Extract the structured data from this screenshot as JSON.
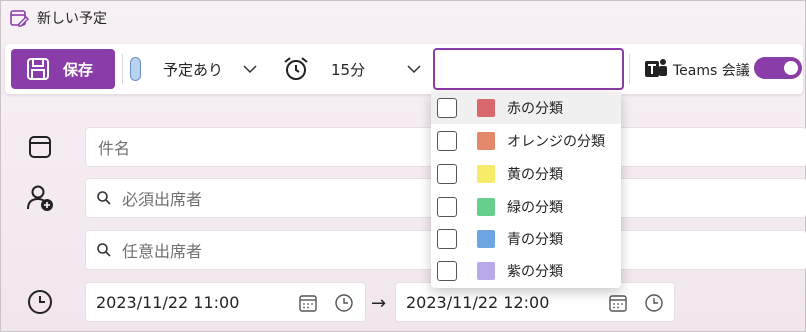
{
  "window": {
    "title": "新しい予定"
  },
  "toolbar": {
    "save_label": "保存",
    "busy_status": "予定あり",
    "reminder": "15分",
    "category_value": "",
    "teams_label": "Teams 会議",
    "teams_enabled": true
  },
  "form": {
    "subject_placeholder": "件名",
    "required_placeholder": "必須出席者",
    "optional_placeholder": "任意出席者",
    "start": "2023/11/22 11:00",
    "end": "2023/11/22 12:00"
  },
  "categories": [
    {
      "label": "赤の分類",
      "color": "#d9686d",
      "checked": false
    },
    {
      "label": "オレンジの分類",
      "color": "#e3896a",
      "checked": false
    },
    {
      "label": "黄の分類",
      "color": "#f6ec6a",
      "checked": false
    },
    {
      "label": "緑の分類",
      "color": "#67cf8d",
      "checked": false
    },
    {
      "label": "青の分類",
      "color": "#6ca5e2",
      "checked": false
    },
    {
      "label": "紫の分類",
      "color": "#b9a9ea",
      "checked": false
    }
  ],
  "colors": {
    "accent": "#8a3ca8"
  }
}
